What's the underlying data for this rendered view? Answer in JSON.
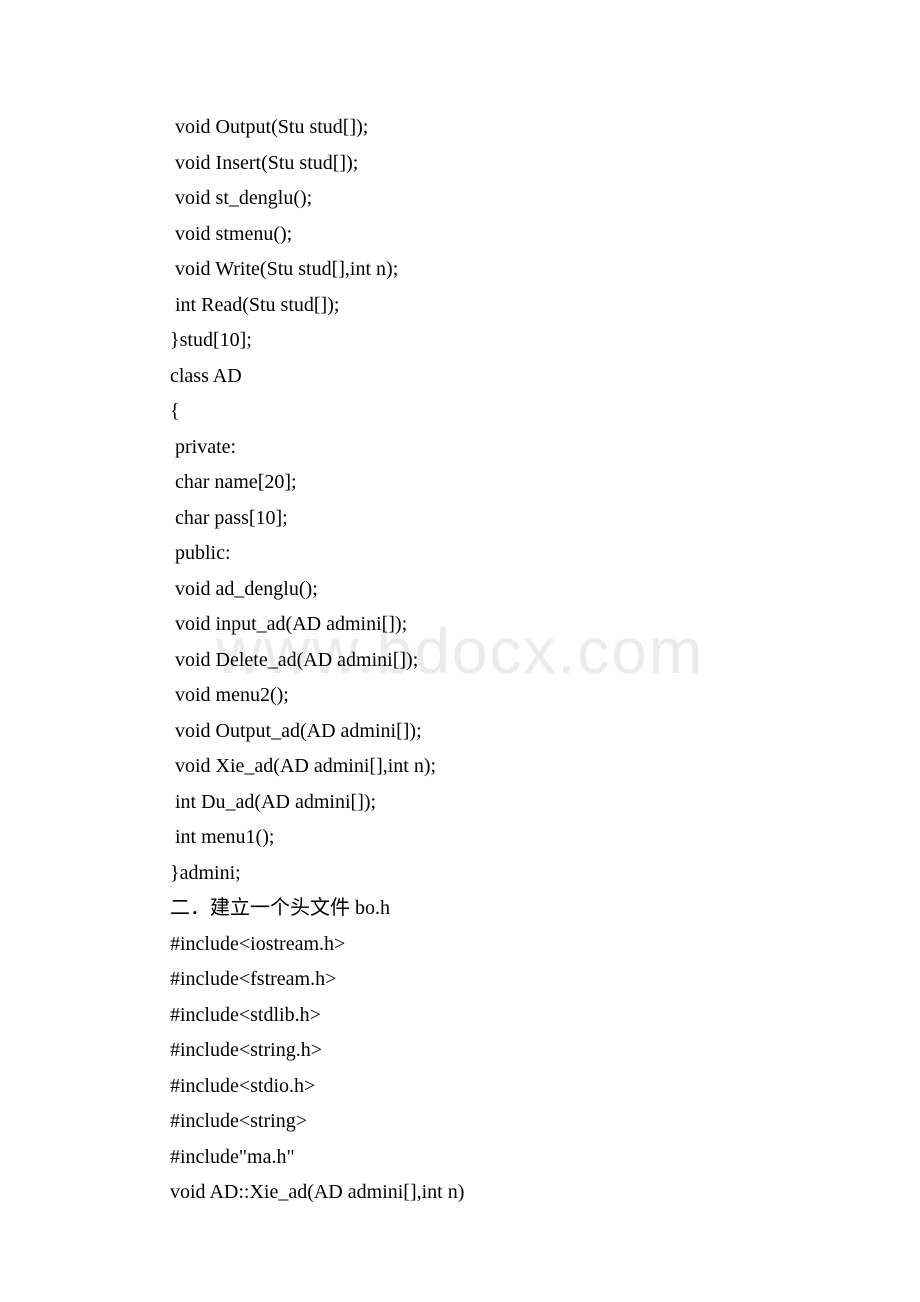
{
  "watermark": "www.bdocx.com",
  "lines": [
    " void Output(Stu stud[]);",
    " void Insert(Stu stud[]);",
    " void st_denglu();",
    " void stmenu();",
    " void Write(Stu stud[],int n);",
    " int Read(Stu stud[]);",
    "}stud[10];",
    "class AD",
    "{",
    " private:",
    " char name[20];",
    " char pass[10];",
    " public:",
    " void ad_denglu();",
    " void input_ad(AD admini[]);",
    " void Delete_ad(AD admini[]);",
    " void menu2();",
    " void Output_ad(AD admini[]);",
    " void Xie_ad(AD admini[],int n);",
    " int Du_ad(AD admini[]);",
    " int menu1();",
    "}admini;",
    "二．建立一个头文件 bo.h",
    "#include<iostream.h>",
    "#include<fstream.h>",
    "#include<stdlib.h>",
    "#include<string.h>",
    "#include<stdio.h>",
    "#include<string>",
    "#include\"ma.h\"",
    "void AD::Xie_ad(AD admini[],int n)"
  ]
}
